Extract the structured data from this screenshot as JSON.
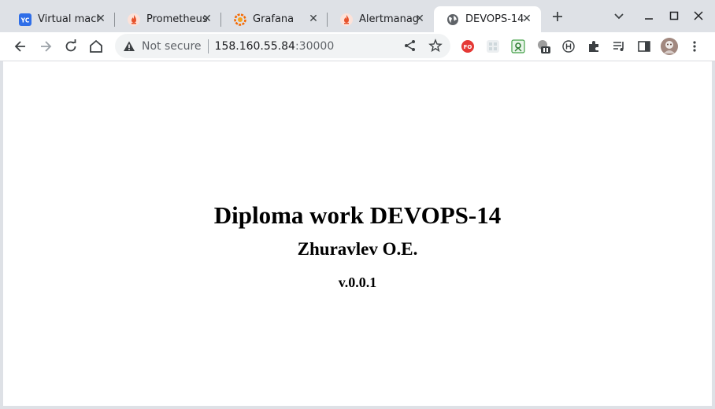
{
  "tabs": [
    {
      "title": "Virtual mach",
      "favicon": "yandex-cloud-icon"
    },
    {
      "title": "Prometheus",
      "favicon": "prometheus-icon"
    },
    {
      "title": "Grafana",
      "favicon": "grafana-icon"
    },
    {
      "title": "Alertmanag",
      "favicon": "alertmanager-icon"
    },
    {
      "title": "DEVOPS-14",
      "favicon": "globe-icon",
      "active": true
    }
  ],
  "tab_favicon_text": {
    "yandex": "YC"
  },
  "toolbar": {
    "security_label": "Not secure",
    "url_host": "158.160.55.84",
    "url_port": ":30000"
  },
  "extensions": {
    "fo_badge": "FO"
  },
  "page": {
    "heading": "Diploma work DEVOPS-14",
    "author": "Zhuravlev O.E.",
    "version": "v.0.0.1"
  },
  "colors": {
    "tabstrip_bg": "#dee1e6",
    "yandex_blue": "#1a73e8",
    "prometheus_orange": "#e6522c",
    "grafana_orange": "#f46800"
  }
}
